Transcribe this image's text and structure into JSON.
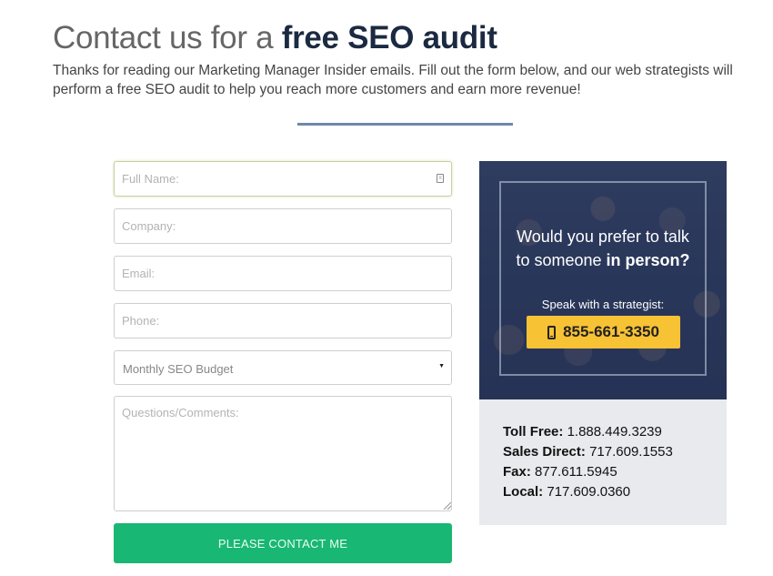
{
  "header": {
    "title_light": "Contact us for a",
    "title_bold": "free SEO audit",
    "intro": "Thanks for reading our Marketing Manager Insider emails. Fill out the form below, and our web strategists will perform a free SEO audit to help you reach more customers and earn more revenue!"
  },
  "form": {
    "full_name_placeholder": "Full Name:",
    "company_placeholder": "Company:",
    "email_placeholder": "Email:",
    "phone_placeholder": "Phone:",
    "budget_selected": "Monthly SEO Budget",
    "comments_placeholder": "Questions/Comments:",
    "submit_label": "PLEASE CONTACT ME"
  },
  "promo": {
    "heading_line1": "Would you prefer to talk",
    "heading_line2_prefix": "to someone",
    "heading_line2_bold": "in person?",
    "subtext": "Speak with a strategist:",
    "phone": "855-661-3350"
  },
  "contacts": [
    {
      "label": "Toll Free:",
      "value": "1.888.449.3239"
    },
    {
      "label": "Sales Direct:",
      "value": "717.609.1553"
    },
    {
      "label": "Fax:",
      "value": "877.611.5945"
    },
    {
      "label": "Local:",
      "value": "717.609.0360"
    }
  ],
  "colors": {
    "accent_green": "#19b774",
    "phone_button": "#f7c234",
    "title_dark": "#1b2a41",
    "divider": "#6f88a8"
  },
  "icons": {
    "field_icon": "id-card-icon",
    "phone_icon": "mobile-phone-icon",
    "select_arrow": "caret-down-icon"
  }
}
